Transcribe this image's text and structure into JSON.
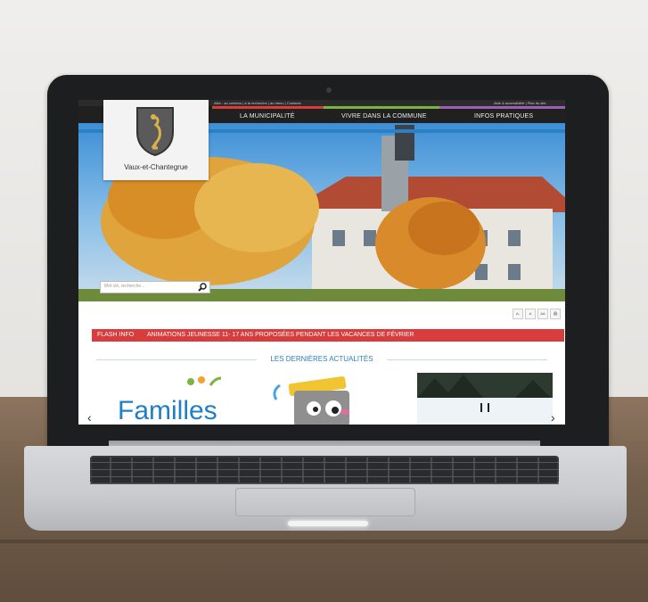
{
  "site": {
    "topbar_left": "Aller : au contenu | à la recherche | au menu | Contacts",
    "topbar_right": "Aide & accessibilité | Plan du site",
    "nav": [
      "LA MUNICIPALITÉ",
      "VIVRE DANS LA COMMUNE",
      "INFOS PRATIQUES"
    ],
    "logo_name": "Vaux-et-Chantegrue",
    "search_placeholder": "Mot clé, recherche...",
    "access_buttons": [
      "A-",
      "A",
      "AA",
      "🖨"
    ],
    "flash_label": "FLASH INFO",
    "flash_text": "ANIMATIONS JEUNESSE 11- 17 ANS PROPOSÉES PENDANT LES VACANCES DE FÉVRIER",
    "news_title": "LES DERNIÈRES ACTUALITÉS",
    "card1_text": "Familles",
    "colors": {
      "accent": "#2b7fc3",
      "flash": "#d83c3c",
      "nav": "#202020"
    }
  },
  "icons": {
    "search": "magnifier-icon",
    "prev": "chevron-left-icon",
    "next": "chevron-right-icon"
  }
}
